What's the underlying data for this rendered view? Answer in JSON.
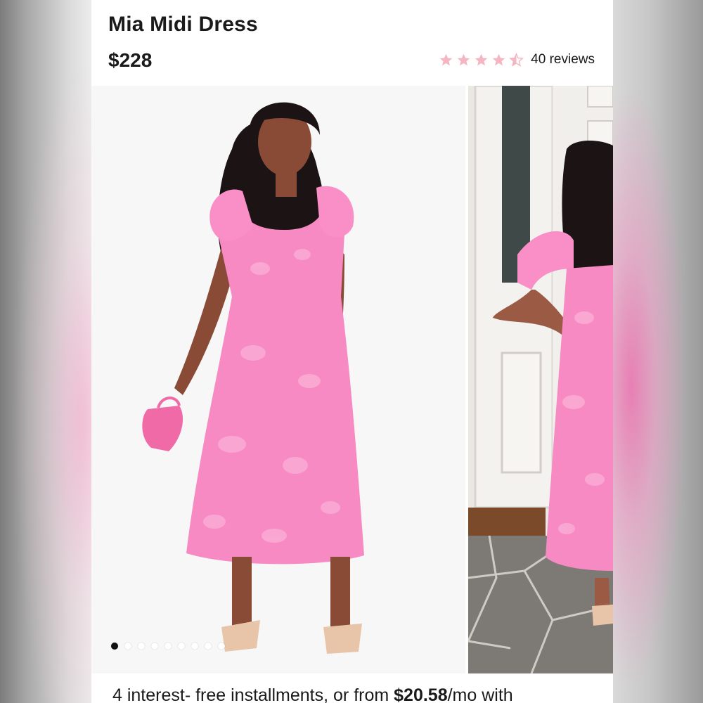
{
  "product": {
    "title": "Mia Midi Dress",
    "price": "$228",
    "rating": 4.5,
    "reviews_label": "40 reviews"
  },
  "gallery": {
    "main_image": "woman-in-pink-midi-dress",
    "side_image": "woman-in-pink-dress-by-white-door",
    "total_slides": 9,
    "active_slide": 1
  },
  "installments": {
    "prefix": "4 interest- free installments, or from ",
    "amount": "$20.58",
    "suffix": "/mo with"
  },
  "colors": {
    "star": "#f4b6c2",
    "dress": "#f78ac2",
    "text": "#1a1a1a"
  },
  "icons": {
    "star": "star-icon",
    "half_star": "half-star-icon",
    "dot": "carousel-dot"
  }
}
